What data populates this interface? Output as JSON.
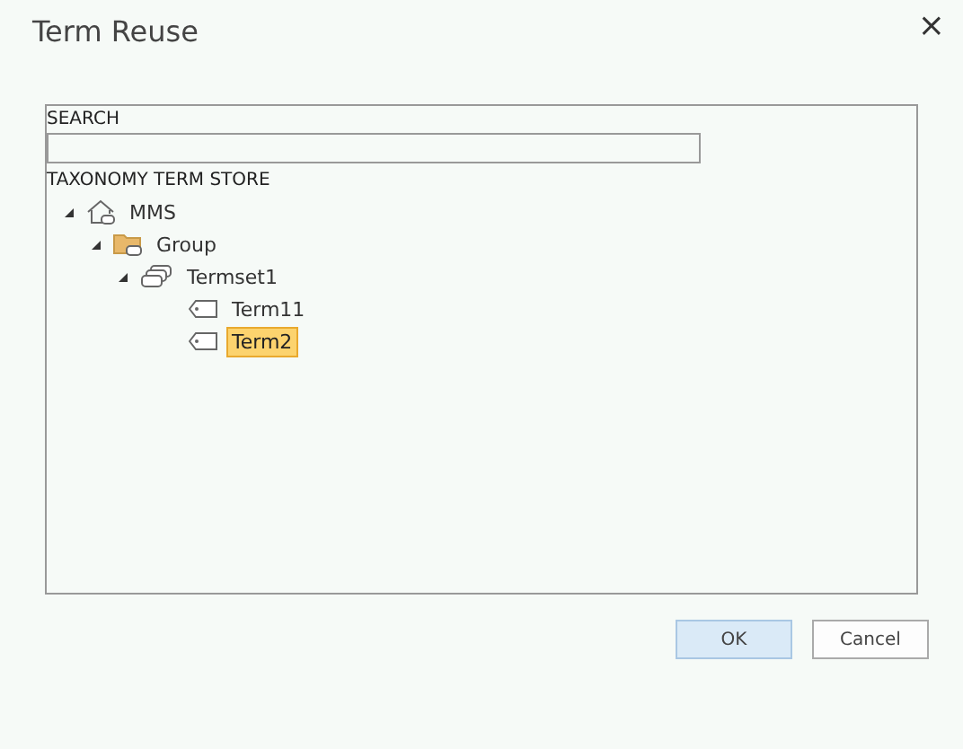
{
  "dialog": {
    "title": "Term Reuse",
    "close": "×"
  },
  "search": {
    "label": "SEARCH"
  },
  "tree": {
    "heading": "TAXONOMY TERM STORE",
    "items": [
      {
        "label": "MMS",
        "kind": "store",
        "expanded": true,
        "selected": false,
        "children": [
          {
            "label": "Group",
            "kind": "group",
            "expanded": true,
            "selected": false,
            "children": [
              {
                "label": "Termset1",
                "kind": "termset",
                "expanded": true,
                "selected": false,
                "children": [
                  {
                    "label": "Term11",
                    "kind": "term",
                    "selected": false
                  },
                  {
                    "label": "Term2",
                    "kind": "term",
                    "selected": true
                  }
                ]
              }
            ]
          }
        ]
      }
    ]
  },
  "buttons": [
    {
      "label": "OK",
      "kind": "primary"
    },
    {
      "label": "Cancel",
      "kind": "secondary"
    }
  ]
}
